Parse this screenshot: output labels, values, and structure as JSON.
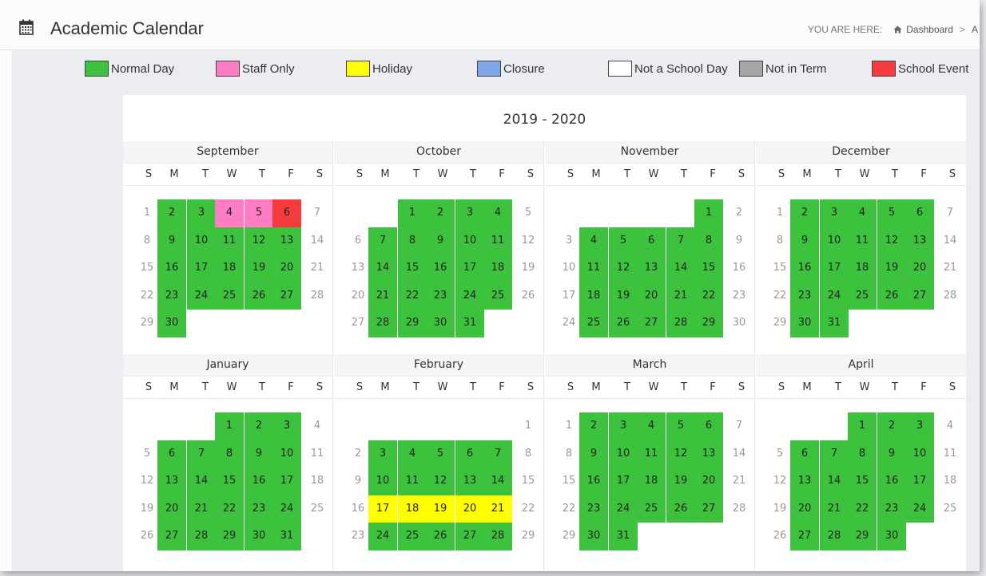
{
  "header": {
    "title": "Academic Calendar",
    "breadcrumb_prefix": "YOU ARE HERE:",
    "breadcrumb_home": "Dashboard",
    "breadcrumb_separator": ">",
    "breadcrumb_next": "A"
  },
  "legend": [
    {
      "label": "Normal Day",
      "color": "#3cc23c"
    },
    {
      "label": "Staff Only",
      "color": "#ff7bc4"
    },
    {
      "label": "Holiday",
      "color": "#ffff00"
    },
    {
      "label": "Closure",
      "color": "#7ea6e8"
    },
    {
      "label": "Not a School Day",
      "color": "#ffffff"
    },
    {
      "label": "Not in Term",
      "color": "#a6a6a6"
    },
    {
      "label": "School Event",
      "color": "#f53b3b"
    }
  ],
  "calendar": {
    "year_label": "2019 - 2020",
    "weekday_labels": [
      "S",
      "M",
      "T",
      "W",
      "T",
      "F",
      "S"
    ],
    "type_colors": {
      "normal": "#3cc23c",
      "staff": "#ff7bc4",
      "holiday": "#ffff00",
      "event": "#f53b3b",
      "none": "transparent"
    },
    "months": [
      {
        "name": "September",
        "first_weekday": 0,
        "days": 30,
        "staff_only": [
          4,
          5
        ],
        "holidays": [],
        "events": [
          6
        ]
      },
      {
        "name": "October",
        "first_weekday": 2,
        "days": 31,
        "staff_only": [],
        "holidays": [],
        "events": []
      },
      {
        "name": "November",
        "first_weekday": 5,
        "days": 30,
        "staff_only": [],
        "holidays": [],
        "events": []
      },
      {
        "name": "December",
        "first_weekday": 0,
        "days": 31,
        "staff_only": [],
        "holidays": [],
        "events": []
      },
      {
        "name": "January",
        "first_weekday": 3,
        "days": 31,
        "staff_only": [],
        "holidays": [],
        "events": []
      },
      {
        "name": "February",
        "first_weekday": 6,
        "days": 29,
        "staff_only": [],
        "holidays": [
          17,
          18,
          19,
          20,
          21
        ],
        "events": []
      },
      {
        "name": "March",
        "first_weekday": 0,
        "days": 31,
        "staff_only": [],
        "holidays": [],
        "events": []
      },
      {
        "name": "April",
        "first_weekday": 3,
        "days": 30,
        "staff_only": [],
        "holidays": [],
        "events": []
      }
    ]
  }
}
